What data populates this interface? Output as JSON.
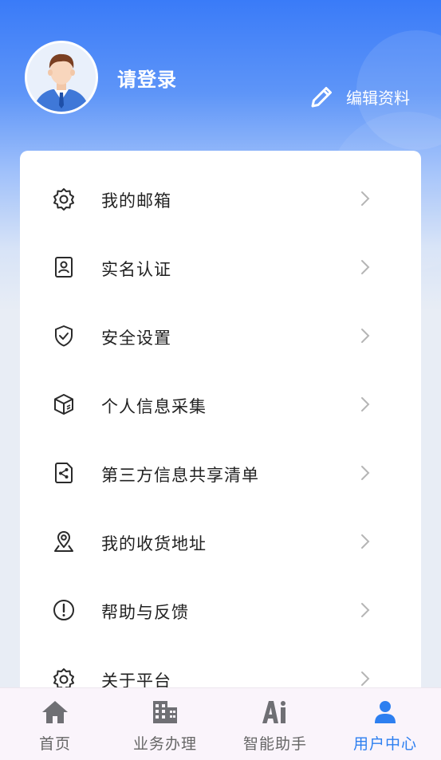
{
  "header": {
    "login_prompt": "请登录",
    "edit_profile": "编辑资料"
  },
  "menu": {
    "items": [
      {
        "label": "我的邮箱",
        "icon": "gear-icon"
      },
      {
        "label": "实名认证",
        "icon": "id-card-icon"
      },
      {
        "label": "安全设置",
        "icon": "shield-icon"
      },
      {
        "label": "个人信息采集",
        "icon": "package-box-icon"
      },
      {
        "label": "第三方信息共享清单",
        "icon": "share-doc-icon"
      },
      {
        "label": "我的收货地址",
        "icon": "location-pin-icon"
      },
      {
        "label": "帮助与反馈",
        "icon": "alert-circle-icon"
      },
      {
        "label": "关于平台",
        "icon": "gear-icon"
      }
    ]
  },
  "tabbar": {
    "tabs": [
      {
        "label": "首页",
        "icon": "home-icon"
      },
      {
        "label": "业务办理",
        "icon": "building-icon"
      },
      {
        "label": "智能助手",
        "icon": "ai-icon"
      },
      {
        "label": "用户中心",
        "icon": "user-icon"
      }
    ],
    "active_index": 3
  },
  "colors": {
    "primary_blue": "#3a7bf8",
    "active_tab": "#2d7ff0",
    "tab_inactive_icon": "#6f6f74"
  }
}
